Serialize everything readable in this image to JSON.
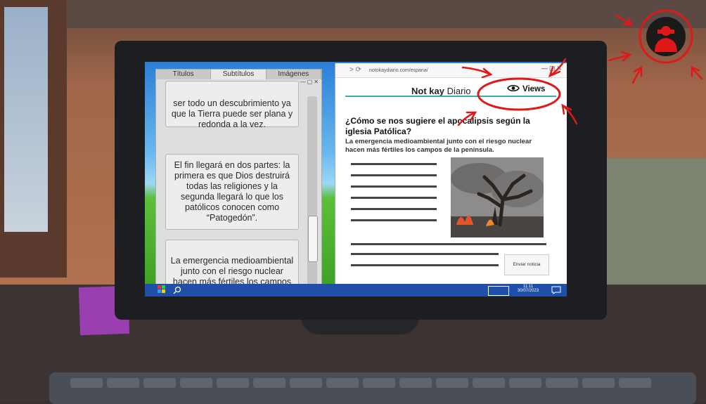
{
  "panel": {
    "tabs": [
      "Títulos",
      "Subtítulos",
      "Imágenes"
    ],
    "active_tab": "Subtítulos",
    "cards": [
      "ser todo un descubrimiento ya que la Tierra puede ser plana y redonda a la vez.",
      "El fin llegará en dos partes: la primera es que Dios destruirá todas las religiones y la segunda llegará lo que los patólicos conocen como “Patogedón”.",
      "La emergencia medioambiental junto con el riesgo nuclear hacen más fértiles los campos de la península."
    ],
    "window_buttons": "—▢✕"
  },
  "browser": {
    "nav": "> ⟳",
    "url": "notokaydiario.com/espana/",
    "window_buttons": "—▢✕",
    "brand_bold": "Not kay",
    "brand_rest": " Diario",
    "views_label": "Views",
    "headline": "¿Cómo se nos sugiere el apocalipsis según la iglesia Patólica?",
    "summary": "La emergencia medioambiental junto con el riesgo nuclear hacen más fértiles los campos de la península.",
    "send_label": "Enviar noticia"
  },
  "taskbar": {
    "time": "11:11",
    "date": "30/07/2023"
  },
  "colors": {
    "accent_teal": "#3ab0a0",
    "annotation_red": "#e01818",
    "taskbar_blue": "#1f4fa8"
  },
  "icons": [
    "eye-icon",
    "user-alert-icon",
    "search-icon",
    "start-icon",
    "notification-icon"
  ]
}
